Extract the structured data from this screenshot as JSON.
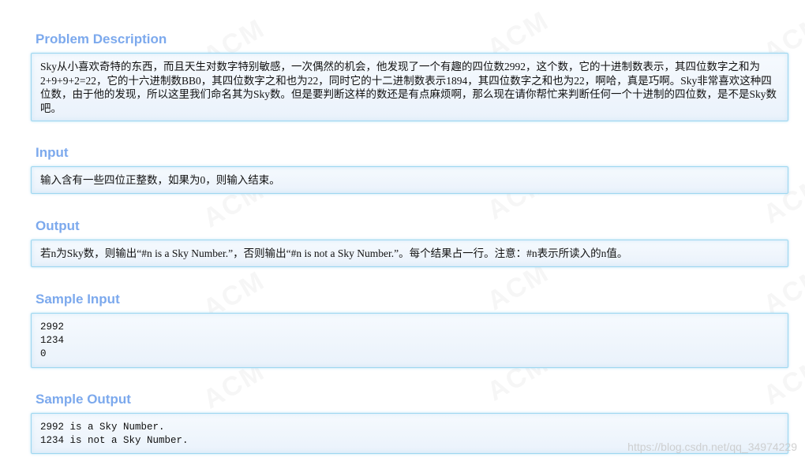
{
  "sections": {
    "description": {
      "title": "Problem Description",
      "text": "Sky从小喜欢奇特的东西，而且天生对数字特别敏感，一次偶然的机会，他发现了一个有趣的四位数2992，这个数，它的十进制数表示，其四位数字之和为2+9+9+2=22，它的十六进制数BB0，其四位数字之和也为22，同时它的十二进制数表示1894，其四位数字之和也为22，啊哈，真是巧啊。Sky非常喜欢这种四位数，由于他的发现，所以这里我们命名其为Sky数。但是要判断这样的数还是有点麻烦啊，那么现在请你帮忙来判断任何一个十进制的四位数，是不是Sky数吧。"
    },
    "input": {
      "title": "Input",
      "text": "输入含有一些四位正整数，如果为0，则输入结束。"
    },
    "output": {
      "title": "Output",
      "text": "若n为Sky数，则输出“#n is a Sky Number.”，否则输出“#n is not a Sky Number.”。每个结果占一行。注意：#n表示所读入的n值。"
    },
    "sample_input": {
      "title": "Sample Input",
      "lines": [
        "2992",
        "1234",
        "0"
      ]
    },
    "sample_output": {
      "title": "Sample Output",
      "lines": [
        "2992 is a Sky Number.",
        "1234 is not a Sky Number."
      ]
    }
  },
  "watermark_text": "ACM",
  "footer_watermark": "https://blog.csdn.net/qq_34974229"
}
